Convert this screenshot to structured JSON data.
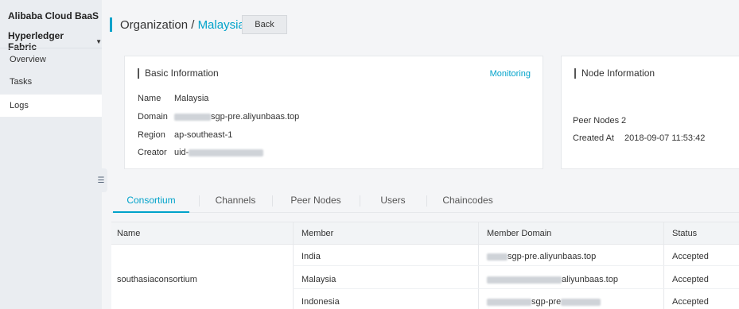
{
  "sidebar": {
    "brand": "Alibaba Cloud BaaS",
    "product": "Hyperledger Fabric",
    "items": [
      {
        "label": "Overview"
      },
      {
        "label": "Tasks"
      },
      {
        "label": "Logs"
      }
    ]
  },
  "header": {
    "breadcrumb_root": "Organization / ",
    "breadcrumb_current": "Malaysia",
    "back_label": "Back"
  },
  "basic_info": {
    "title": "Basic Information",
    "monitoring_label": "Monitoring",
    "fields": [
      {
        "label": "Name",
        "value": "Malaysia"
      },
      {
        "label": "Domain",
        "value": "sgp-pre.aliyunbaas.top"
      },
      {
        "label": "Region",
        "value": "ap-southeast-1"
      },
      {
        "label": "Creator",
        "value": "uid-"
      }
    ]
  },
  "node_info": {
    "title": "Node Information",
    "fields": [
      {
        "label": "Peer Nodes",
        "value": "2"
      },
      {
        "label": "Created At",
        "value": "2018-09-07 11:53:42"
      }
    ]
  },
  "tabs": [
    {
      "label": "Consortium",
      "active": true
    },
    {
      "label": "Channels"
    },
    {
      "label": "Peer Nodes"
    },
    {
      "label": "Users"
    },
    {
      "label": "Chaincodes"
    }
  ],
  "table": {
    "headers": [
      "Name",
      "Member",
      "Member Domain",
      "Status"
    ],
    "consortium_name": "southasiaconsortium",
    "rows": [
      {
        "member": "India",
        "domain_visible": "sgp-pre.aliyunbaas.top",
        "status": "Accepted"
      },
      {
        "member": "Malaysia",
        "domain_visible": "aliyunbaas.top",
        "status": "Accepted"
      },
      {
        "member": "Indonesia",
        "domain_visible": "sgp-pre",
        "status": "Accepted"
      }
    ]
  },
  "colors": {
    "accent": "#00a2ca",
    "sidebar_bg": "#eaedf1",
    "page_bg": "#f4f5f7"
  }
}
